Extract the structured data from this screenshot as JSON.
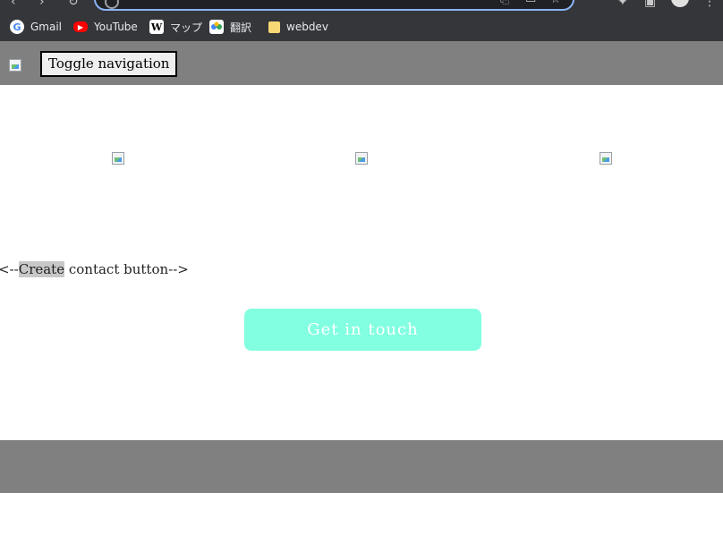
{
  "browser": {
    "bookmarks": [
      {
        "label": "Gmail",
        "icon": "gmail-icon"
      },
      {
        "label": "YouTube",
        "icon": "youtube-icon"
      },
      {
        "label": "マップ",
        "icon": "wikipedia-icon"
      },
      {
        "label": "翻訳",
        "icon": "translate-icon"
      },
      {
        "label": "webdev",
        "icon": "folder-icon"
      }
    ],
    "accent_color": "#8ab4f8",
    "chrome_color": "#35363a"
  },
  "navbar": {
    "toggle_label": "Toggle navigation",
    "background_color": "#808080"
  },
  "content": {
    "comment_before": "<--",
    "comment_highlight": "Create",
    "comment_after": " contact button-->",
    "cta_label": "Get in touch",
    "cta_color": "#82ffe0"
  },
  "footer": {
    "background_color": "#808080"
  }
}
